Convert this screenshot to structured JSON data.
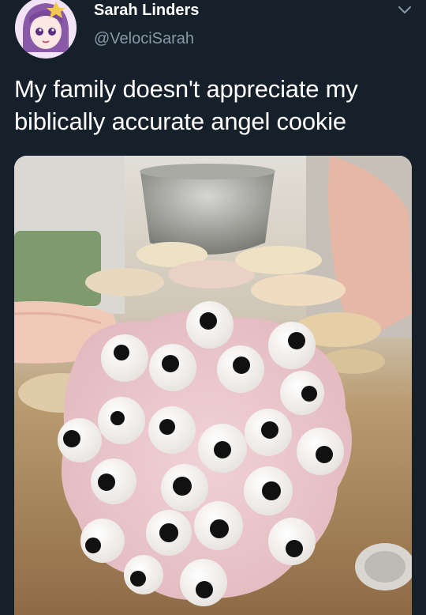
{
  "tweet": {
    "display_name": "Sarah Linders",
    "handle": "@VelociSarah",
    "text": "My family doesn't appreciate my biblically accurate angel cookie"
  },
  "icons": {
    "menu": "chevron-down-icon",
    "avatar": "anime-avatar-icon"
  },
  "media": {
    "description_alt": "photo",
    "cookie_color": "#eac6cc",
    "eye_white": "#f5f3f1",
    "pupil": "#111111"
  },
  "colors": {
    "background": "#15202b",
    "secondary_text": "#8899a6"
  }
}
